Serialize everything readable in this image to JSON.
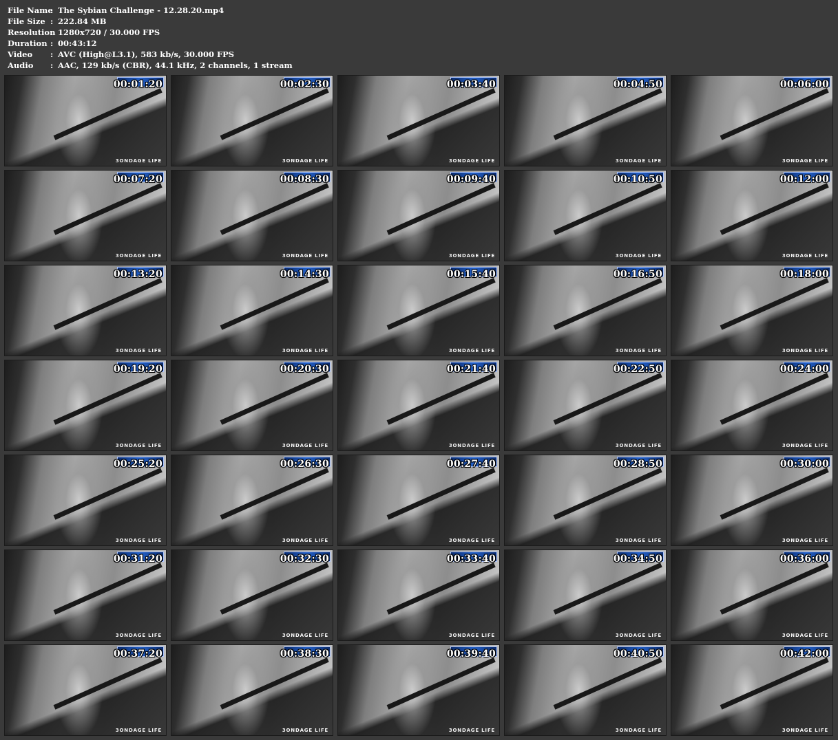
{
  "info": [
    {
      "label": "File Name",
      "value": "The Sybian Challenge - 12.28.20.mp4"
    },
    {
      "label": "File Size",
      "value": "222.84 MB"
    },
    {
      "label": "Resolution",
      "value": "1280x720 / 30.000 FPS"
    },
    {
      "label": "Duration",
      "value": "00:43:12"
    },
    {
      "label": "Video",
      "value": "AVC (High@L3.1), 583 kb/s, 30.000 FPS"
    },
    {
      "label": "Audio",
      "value": "AAC, 129 kb/s (CBR), 44.1 kHz, 2 channels, 1 stream"
    }
  ],
  "separator": ":",
  "watermark": "3ONDAGE LIFE",
  "timestamps": [
    "00:01:20",
    "00:02:30",
    "00:03:40",
    "00:04:50",
    "00:06:00",
    "00:07:20",
    "00:08:30",
    "00:09:40",
    "00:10:50",
    "00:12:00",
    "00:13:20",
    "00:14:30",
    "00:15:40",
    "00:16:50",
    "00:18:00",
    "00:19:20",
    "00:20:30",
    "00:21:40",
    "00:22:50",
    "00:24:00",
    "00:25:20",
    "00:26:30",
    "00:27:40",
    "00:28:50",
    "00:30:00",
    "00:31:20",
    "00:32:30",
    "00:33:40",
    "00:34:50",
    "00:36:00",
    "00:37:20",
    "00:38:30",
    "00:39:40",
    "00:40:50",
    "00:42:00"
  ]
}
